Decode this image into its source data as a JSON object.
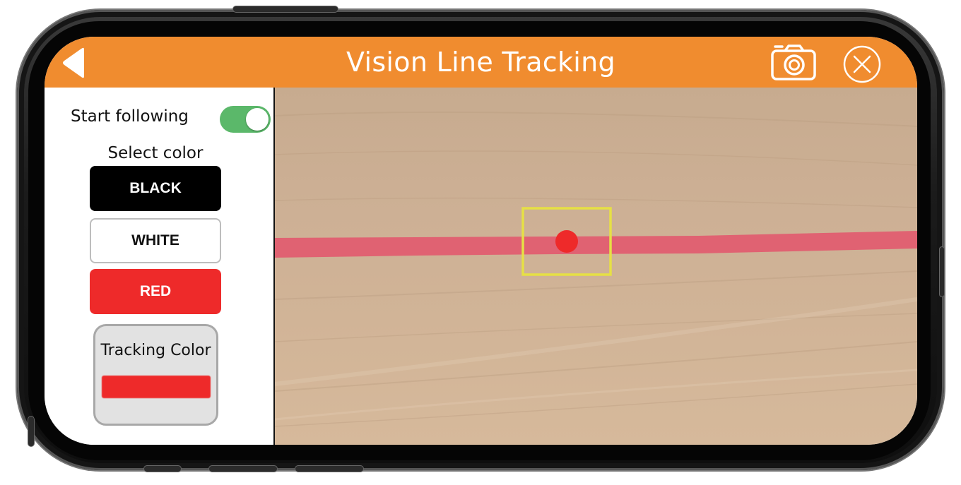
{
  "header": {
    "title": "Vision Line Tracking",
    "bar_color": "#f08c2f",
    "back_icon": "back-arrow-icon",
    "camera_icon": "camera-icon",
    "close_icon": "close-icon"
  },
  "sidebar": {
    "follow_label": "Start following",
    "follow_enabled": true,
    "select_color_label": "Select color",
    "color_buttons": [
      {
        "label": "BLACK",
        "color": "#000000"
      },
      {
        "label": "WHITE",
        "color": "#ffffff"
      },
      {
        "label": "RED",
        "color": "#ee2a2a"
      }
    ],
    "tracking_label": "Tracking Color",
    "tracking_color": "#ee2a2a"
  },
  "camera": {
    "line_color": "#e06272",
    "target_box_color": "#e6e045",
    "target_dot_color": "#ee2a2a"
  }
}
